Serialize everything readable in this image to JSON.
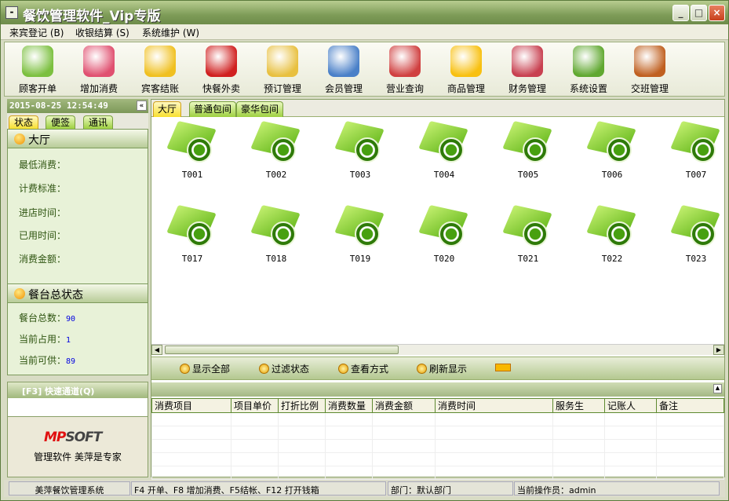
{
  "window": {
    "title": "餐饮管理软件_Vip专版",
    "minimize": "_",
    "maximize": "□",
    "close": "×"
  },
  "menu": [
    "来宾登记 (B)",
    "收银结算 (S)",
    "系统维护 (W)"
  ],
  "toolbar": [
    {
      "label": "顾客开单",
      "icon": "tea-cup-icon",
      "color": "#7cc040"
    },
    {
      "label": "增加消费",
      "icon": "add-plus-icon",
      "color": "#e05070"
    },
    {
      "label": "宾客结账",
      "icon": "dollar-arrow-icon",
      "color": "#f0c020"
    },
    {
      "label": "快餐外卖",
      "icon": "coffee-cup-icon",
      "color": "#d02020"
    },
    {
      "label": "预订管理",
      "icon": "clock-icon",
      "color": "#e8c040"
    },
    {
      "label": "会员管理",
      "icon": "users-icon",
      "color": "#4a80c8"
    },
    {
      "label": "营业查询",
      "icon": "notebook-icon",
      "color": "#d04040"
    },
    {
      "label": "商品管理",
      "icon": "star-icon",
      "color": "#f8c010"
    },
    {
      "label": "财务管理",
      "icon": "calculator-icon",
      "color": "#c84050"
    },
    {
      "label": "系统设置",
      "icon": "gears-icon",
      "color": "#60a830"
    },
    {
      "label": "交班管理",
      "icon": "exit-door-icon",
      "color": "#c06020"
    }
  ],
  "left": {
    "datetime": "2015-08-25 12:54:49",
    "collapse": "«",
    "tabs": [
      "状态",
      "便签",
      "通讯"
    ],
    "hall": {
      "title": "大厅",
      "fields": [
        "最低消费：",
        "计费标准：",
        "进店时间：",
        "已用时间：",
        "消费金额："
      ]
    },
    "summary": {
      "title": "餐台总状态",
      "rows": [
        {
          "label": "餐台总数：",
          "value": "90"
        },
        {
          "label": "当前占用：",
          "value": "1"
        },
        {
          "label": "当前可供：",
          "value": "89"
        }
      ]
    },
    "quick": {
      "title": "[F3] 快速通道(Q)",
      "input": ""
    },
    "logo": "MPSOFT",
    "slogan": "管理软件  美萍是专家"
  },
  "room_tabs": [
    "大厅",
    "普通包间",
    "豪华包间"
  ],
  "tables": [
    "T001",
    "T002",
    "T003",
    "T004",
    "T005",
    "T006",
    "T007",
    "T017",
    "T018",
    "T019",
    "T020",
    "T021",
    "T022",
    "T023"
  ],
  "actions": [
    "显示全部",
    "过滤状态",
    "查看方式",
    "刷新显示"
  ],
  "detail": {
    "columns": [
      "消费项目",
      "项目单价",
      "打折比例",
      "消费数量",
      "消费金额",
      "消费时间",
      "服务生",
      "记账人",
      "备注"
    ]
  },
  "status": [
    "美萍餐饮管理系统",
    "F4 开单、F8 增加消费、F5结帐、F12 打开钱箱",
    "部门：默认部门",
    "当前操作员：admin"
  ],
  "colors": {
    "accent": "#7e9c58",
    "value": "#0000e0"
  }
}
